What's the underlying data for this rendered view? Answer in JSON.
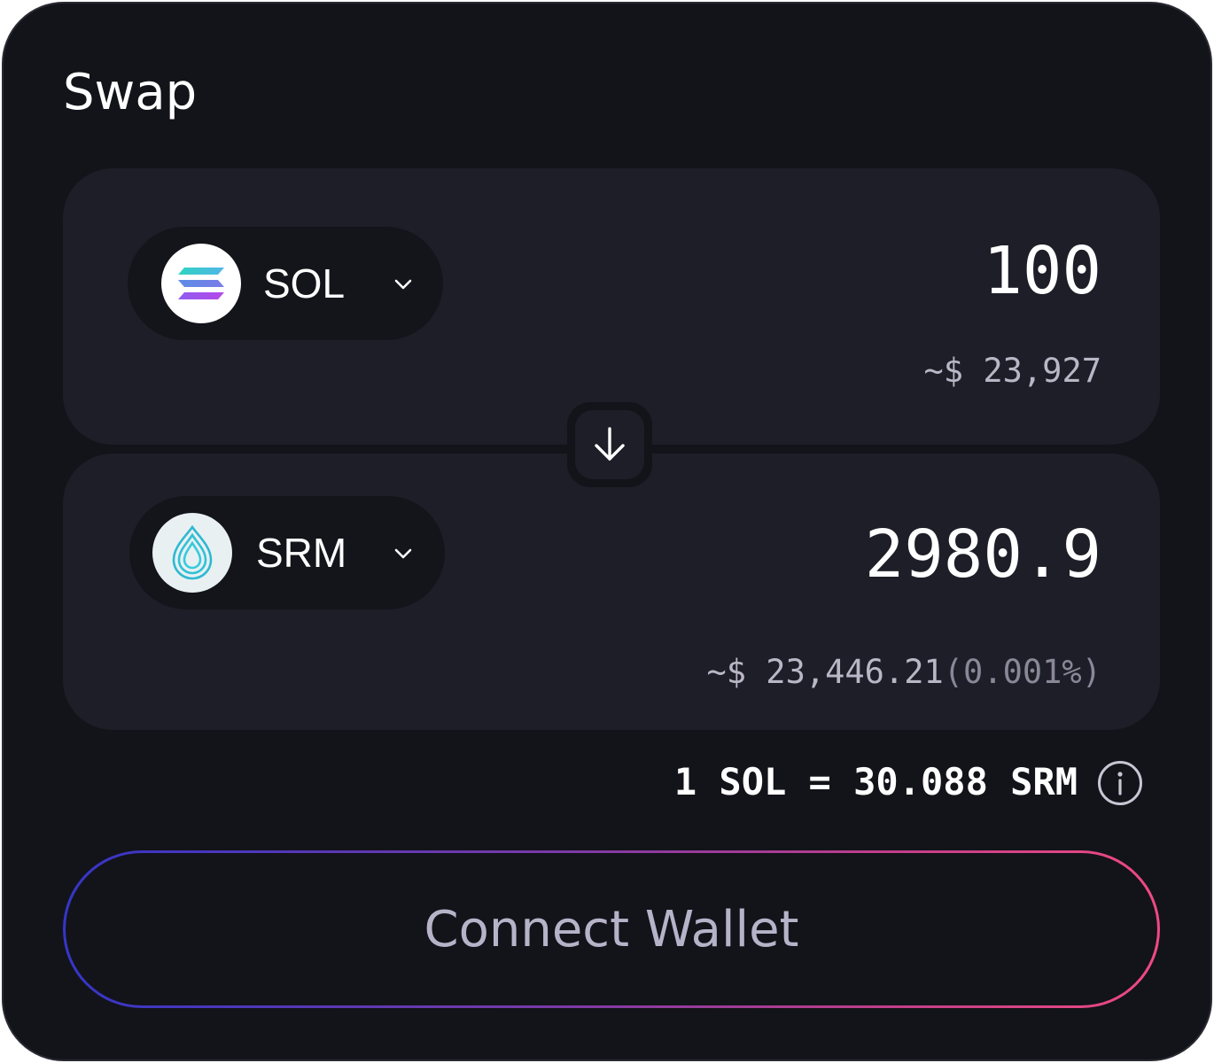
{
  "title": "Swap",
  "from": {
    "token": "SOL",
    "token_icon": "solana-logo-icon",
    "amount": "100",
    "usd": "~$ 23,927"
  },
  "to": {
    "token": "SRM",
    "token_icon": "serum-logo-icon",
    "amount": "2980.9",
    "usd": "~$ 23,446.21",
    "price_impact": "(0.001%)"
  },
  "rate": "1 SOL = 30.088 SRM",
  "connect_label": "Connect Wallet",
  "colors": {
    "background": "#13131a",
    "panel": "#1e1e28",
    "gradient_start": "#3436c6",
    "gradient_end": "#ee4a82",
    "muted_text": "#b9b7c6"
  }
}
